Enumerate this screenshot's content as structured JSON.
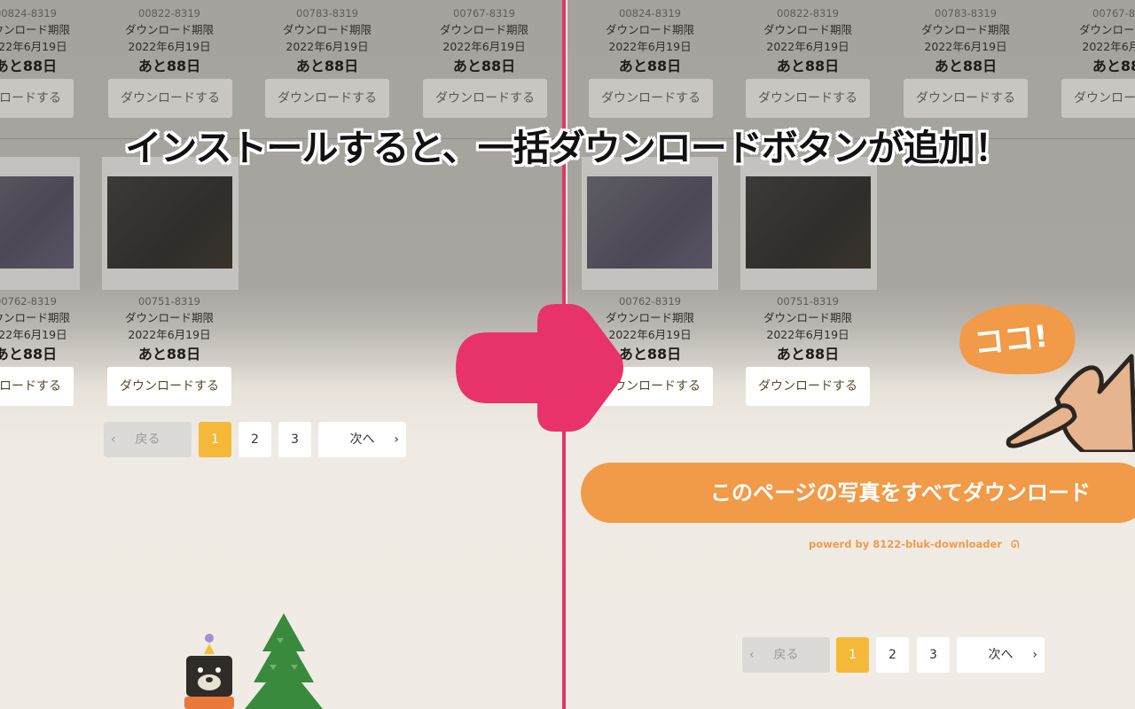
{
  "caption": "インストールすると、一括ダウンロードボタンが追加！",
  "callout": "ココ!",
  "top_row_ids": [
    "00824-8319",
    "00822-8319",
    "00783-8319",
    "00767-8319"
  ],
  "bottom_row_ids": [
    "00762-8319",
    "00751-8319"
  ],
  "expiry_label": "ダウンロード期限",
  "expiry_date": "2022年6月19日",
  "remaining": "あと88日",
  "download_label": "ダウンロードする",
  "pagination": {
    "prev": "戻る",
    "pages": [
      "1",
      "2",
      "3"
    ],
    "next": "次へ"
  },
  "bulk_button": "このページの写真をすべてダウンロード",
  "powered_by": "powerd by 8122-bluk-downloader",
  "colors": {
    "accent": "#f19a48",
    "arrow": "#e8336a",
    "page_active": "#f5b93a"
  }
}
